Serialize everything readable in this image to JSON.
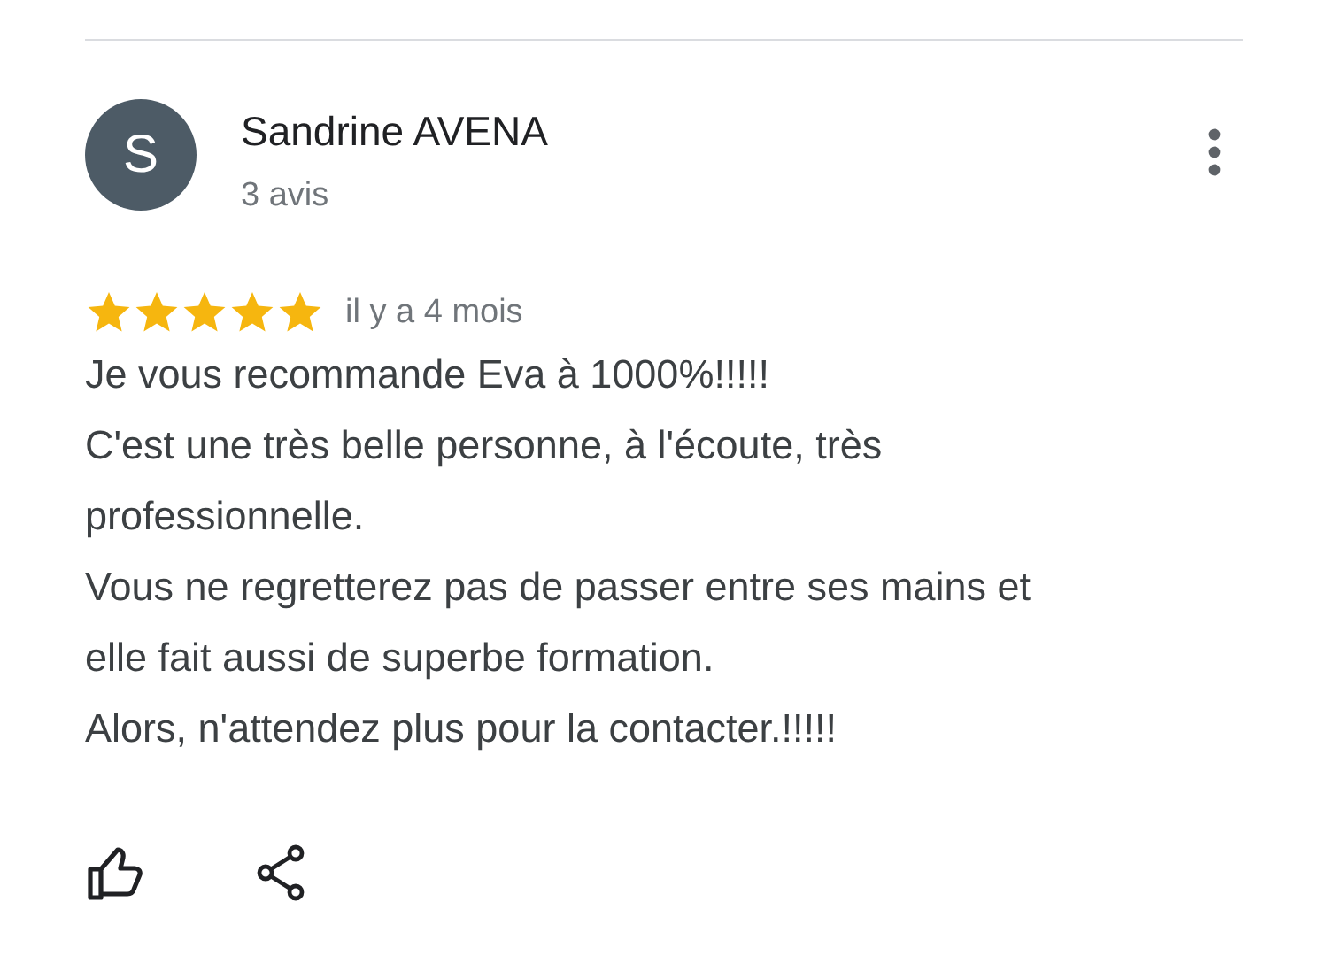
{
  "review": {
    "avatar_letter": "S",
    "author": "Sandrine AVENA",
    "review_count": "3 avis",
    "stars": 5,
    "time": "il y a 4 mois",
    "text": "Je vous recommande Eva à 1000%!!!!!\nC'est une très belle personne, à l'écoute, très professionnelle.\nVous ne regretterez pas de passer entre ses mains et elle fait aussi de superbe formation.\nAlors, n'attendez plus pour la contacter.!!!!!"
  }
}
